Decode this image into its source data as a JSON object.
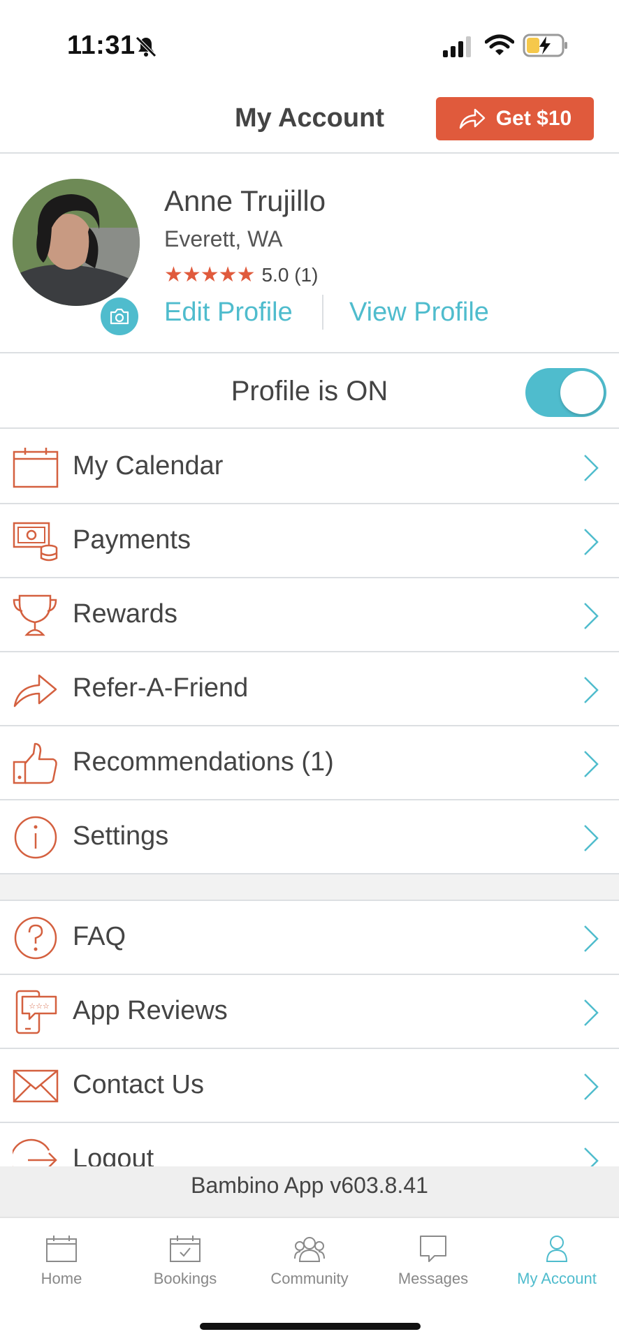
{
  "status_bar": {
    "time": "11:31"
  },
  "header": {
    "title": "My Account",
    "get_button_label": "Get $10"
  },
  "profile": {
    "name": "Anne Trujillo",
    "location": "Everett, WA",
    "stars": "★★★★★",
    "rating": "5.0 (1)",
    "edit_label": "Edit Profile",
    "view_label": "View Profile"
  },
  "profile_toggle": {
    "label": "Profile is ON",
    "on": true
  },
  "menu_primary": [
    {
      "label": "My Calendar",
      "icon": "calendar-icon"
    },
    {
      "label": "Payments",
      "icon": "payments-icon"
    },
    {
      "label": "Rewards",
      "icon": "trophy-icon"
    },
    {
      "label": "Refer-A-Friend",
      "icon": "share-arrow-icon"
    },
    {
      "label": "Recommendations (1)",
      "icon": "thumbs-up-icon"
    },
    {
      "label": "Settings",
      "icon": "info-icon"
    }
  ],
  "menu_secondary": [
    {
      "label": "FAQ",
      "icon": "question-icon"
    },
    {
      "label": "App Reviews",
      "icon": "app-reviews-icon"
    },
    {
      "label": "Contact Us",
      "icon": "envelope-icon"
    },
    {
      "label": "Logout",
      "icon": "logout-icon"
    }
  ],
  "version": "Bambino App v603.8.41",
  "tabs": [
    {
      "label": "Home",
      "icon": "calendar-home-icon",
      "active": false
    },
    {
      "label": "Bookings",
      "icon": "calendar-check-icon",
      "active": false
    },
    {
      "label": "Community",
      "icon": "people-icon",
      "active": false
    },
    {
      "label": "Messages",
      "icon": "chat-icon",
      "active": false
    },
    {
      "label": "My Account",
      "icon": "person-icon",
      "active": true
    }
  ],
  "colors": {
    "accent": "#4fbccd",
    "brand": "#e05a3c",
    "text": "#444444",
    "divider": "#dcdfe2"
  }
}
